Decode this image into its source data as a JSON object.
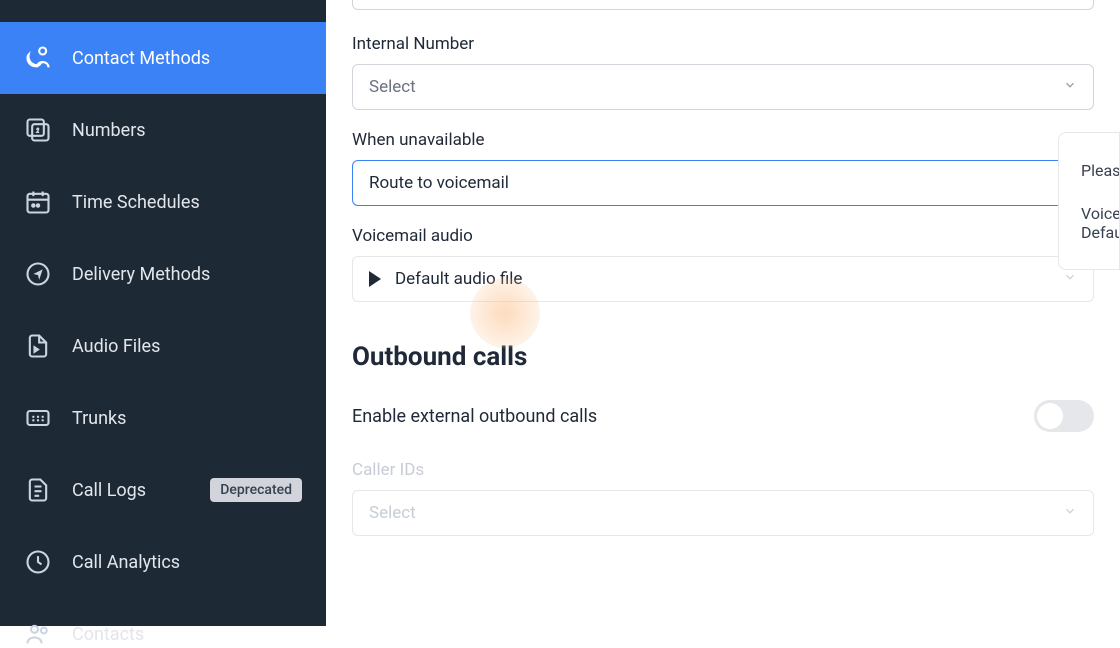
{
  "sidebar": {
    "items": [
      {
        "label": "Contact Methods",
        "icon": "contact-methods-icon",
        "active": true
      },
      {
        "label": "Numbers",
        "icon": "numbers-icon"
      },
      {
        "label": "Time Schedules",
        "icon": "schedules-icon"
      },
      {
        "label": "Delivery Methods",
        "icon": "delivery-icon"
      },
      {
        "label": "Audio Files",
        "icon": "audio-icon"
      },
      {
        "label": "Trunks",
        "icon": "trunks-icon"
      },
      {
        "label": "Call Logs",
        "icon": "call-logs-icon",
        "badge": "Deprecated"
      },
      {
        "label": "Call Analytics",
        "icon": "analytics-icon"
      },
      {
        "label": "Contacts",
        "icon": "contacts-icon"
      }
    ]
  },
  "form": {
    "internal_number_label": "Internal Number",
    "internal_number_value": "Select",
    "when_unavailable_label": "When unavailable",
    "when_unavailable_value": "Route to voicemail",
    "voicemail_audio_label": "Voicemail audio",
    "voicemail_audio_value": "Default audio file",
    "outbound_section_title": "Outbound calls",
    "enable_external_label": "Enable external outbound calls",
    "caller_ids_label": "Caller IDs",
    "caller_ids_value": "Select"
  },
  "tooltip": {
    "line1": "Pleas",
    "line2": "Voice",
    "line3": "Defau"
  }
}
